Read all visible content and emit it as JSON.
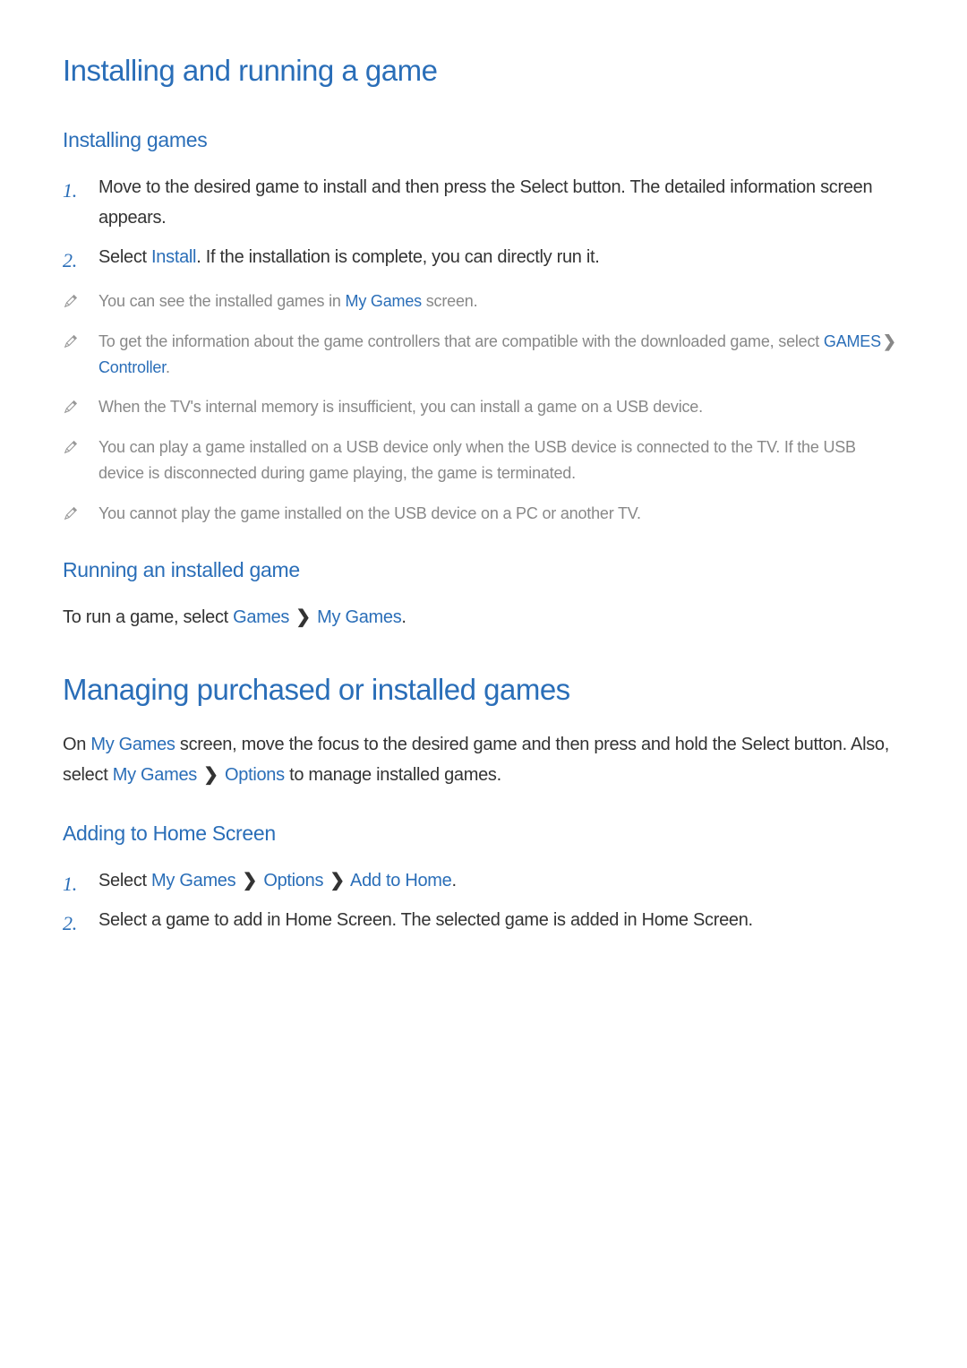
{
  "headings": {
    "h1": "Installing and running a game",
    "installing_games": "Installing games",
    "running_installed": "Running an installed game",
    "managing": "Managing purchased or installed games",
    "adding_home": "Adding to Home Screen"
  },
  "installing_steps": [
    {
      "text_before": "Move to the desired game to install and then press the Select button. The detailed information screen appears."
    },
    {
      "text_before": "Select ",
      "link1": "Install",
      "text_after": ". If the installation is complete, you can directly run it."
    }
  ],
  "notes": [
    {
      "t1": "You can see the installed games in ",
      "l1": "My Games",
      "t2": " screen."
    },
    {
      "t1": "To get the information about the game controllers that are compatible with the downloaded game, select ",
      "l1": "GAMES",
      "chev": " > ",
      "l2": "Controller",
      "t2": "."
    },
    {
      "t1": "When the TV's internal memory is insufficient, you can install a game on a USB device."
    },
    {
      "t1": "You can play a game installed on a USB device only when the USB device is connected to the TV. If the USB device is disconnected during game playing, the game is terminated."
    },
    {
      "t1": "You cannot play the game installed on the USB device on a PC or another TV."
    }
  ],
  "running": {
    "t1": "To run a game, select ",
    "l1": "Games",
    "chev": " > ",
    "l2": "My Games",
    "t2": "."
  },
  "managing_p": {
    "t1": "On ",
    "l1": "My Games",
    "t2": " screen, move the focus to the desired game and then press and hold the Select button. Also, select ",
    "l2": "My Games",
    "chev": " > ",
    "l3": "Options",
    "t3": " to manage installed games."
  },
  "adding_steps": [
    {
      "t1": "Select ",
      "l1": "My Games",
      "chev1": " > ",
      "l2": "Options",
      "chev2": " > ",
      "l3": "Add to Home",
      "t2": "."
    },
    {
      "t1": "Select a game to add in Home Screen. The selected game is added in Home Screen."
    }
  ]
}
